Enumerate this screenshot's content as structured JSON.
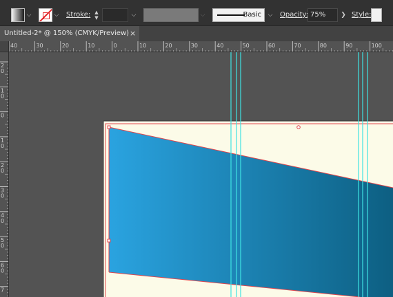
{
  "control_bar": {
    "stroke_label": "Stroke:",
    "stroke_profile": "Basic",
    "opacity_label": "Opacity:",
    "opacity_value": "75%",
    "style_label": "Style:",
    "fill_icon": "gradient-fill-swatch-icon",
    "stroke_icon": "none-stroke-swatch-icon"
  },
  "document_tab": {
    "title": "Untitled-2* @ 150% (CMYK/Preview)",
    "close_glyph": "×"
  },
  "rulers": {
    "horizontal_labels": [
      "40",
      "30",
      "20",
      "10",
      "0",
      "10",
      "20",
      "30",
      "40",
      "50",
      "60",
      "70",
      "80",
      "90",
      "100"
    ],
    "vertical_labels": [
      "2\n0",
      "1\n0",
      "0",
      "1\n0",
      "2\n0",
      "3\n0",
      "4\n0",
      "5\n0",
      "6\n0",
      "7"
    ]
  },
  "colors": {
    "gradient_start": "#2aa3e0",
    "gradient_end": "#0d5f82",
    "artboard": "#fcfbe8",
    "guides": "#3fe3e3",
    "selection": "#e0454c"
  }
}
